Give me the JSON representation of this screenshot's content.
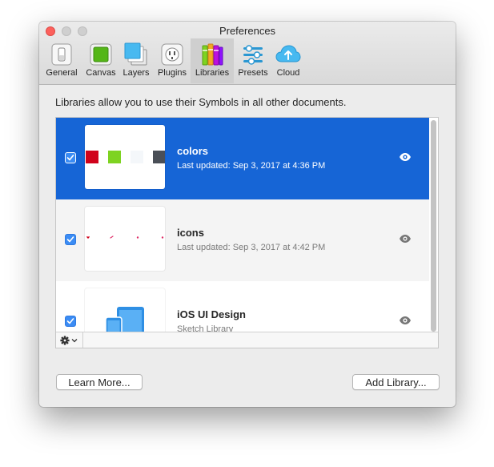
{
  "window": {
    "title": "Preferences"
  },
  "toolbar": {
    "tabs": [
      {
        "label": "General",
        "icon": "switch-icon"
      },
      {
        "label": "Canvas",
        "icon": "canvas-icon"
      },
      {
        "label": "Layers",
        "icon": "layers-icon"
      },
      {
        "label": "Plugins",
        "icon": "plug-icon"
      },
      {
        "label": "Libraries",
        "icon": "books-icon",
        "active": true
      },
      {
        "label": "Presets",
        "icon": "sliders-icon"
      },
      {
        "label": "Cloud",
        "icon": "cloud-upload-icon"
      }
    ]
  },
  "libraries": {
    "description": "Libraries allow you to use their Symbols in all other documents.",
    "items": [
      {
        "name": "colors",
        "subtitle": "Last updated: Sep 3, 2017 at 4:36 PM",
        "checked": true,
        "selected": true,
        "swatches": [
          "#d0021b",
          "#7ed321",
          "#f4f7fa",
          "#4a4f57"
        ]
      },
      {
        "name": "icons",
        "subtitle": "Last updated: Sep 3, 2017 at 4:42 PM",
        "checked": true,
        "selected": false
      },
      {
        "name": "iOS UI Design",
        "subtitle": "Sketch Library",
        "checked": true,
        "selected": false
      }
    ]
  },
  "buttons": {
    "learn_more": "Learn More...",
    "add_library": "Add Library..."
  },
  "colors": {
    "selection": "#1665d6",
    "checkbox": "#3b8cf4",
    "close": "#fc605c"
  }
}
